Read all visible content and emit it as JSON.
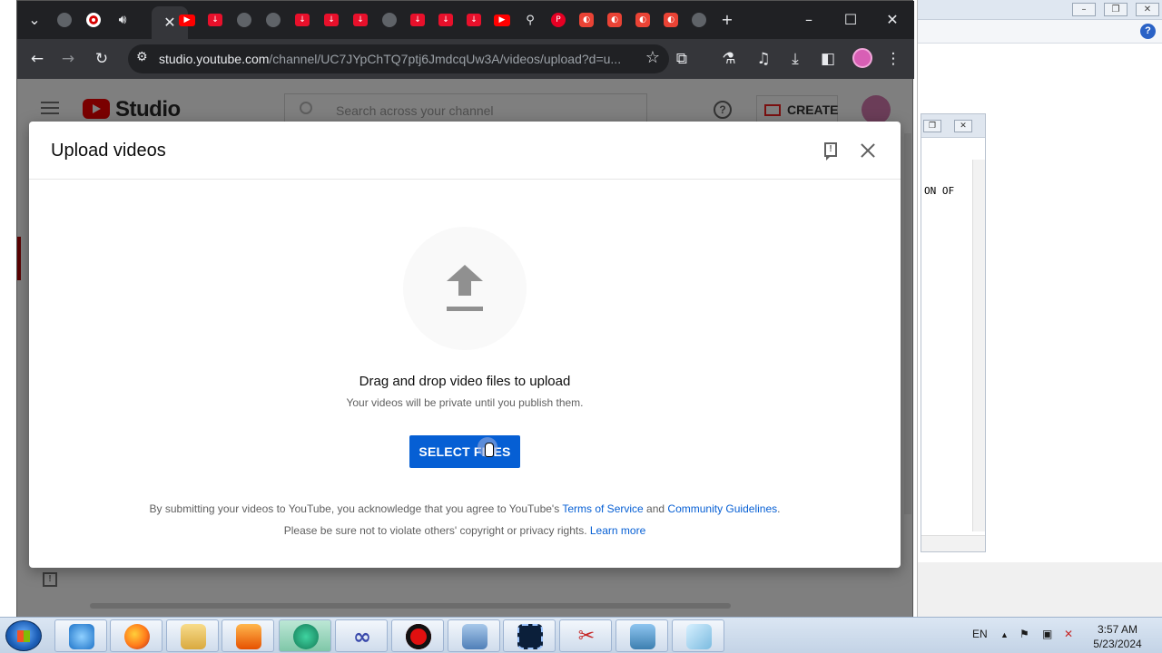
{
  "background_app": {
    "snippet_text": "ON OF"
  },
  "browser": {
    "url_host": "studio.youtube.com",
    "url_path": "/channel/UC7JYpChTQ7ptj6JmdcqUw3A/videos/upload?d=u...",
    "tabs": [
      {
        "icon": "globe-icon"
      },
      {
        "icon": "record-icon"
      },
      {
        "icon": "audio-icon"
      },
      {
        "icon": "youtube-icon"
      },
      {
        "icon": "download-icon"
      },
      {
        "icon": "globe-icon"
      }
    ]
  },
  "studio": {
    "logo_text": "Studio",
    "search_placeholder": "Search across your channel",
    "help_glyph": "?",
    "create_label": "CREATE"
  },
  "dialog": {
    "title": "Upload videos",
    "drag_text": "Drag and drop video files to upload",
    "private_text": "Your videos will be private until you publish them.",
    "select_button": "SELECT FILES",
    "legal_line1_prefix": "By submitting your videos to YouTube, you acknowledge that you agree to YouTube's ",
    "terms_link": "Terms of Service",
    "legal_and": " and ",
    "guidelines_link": "Community Guidelines",
    "legal_period": ".",
    "legal_line2_prefix": "Please be sure not to violate others' copyright or privacy rights. ",
    "learn_more_link": "Learn more"
  },
  "taskbar": {
    "language": "EN",
    "time": "3:57 AM",
    "date": "5/23/2024"
  },
  "colors": {
    "accent_blue": "#065fd4",
    "youtube_red": "#ff0000",
    "browser_dark": "#202124"
  }
}
